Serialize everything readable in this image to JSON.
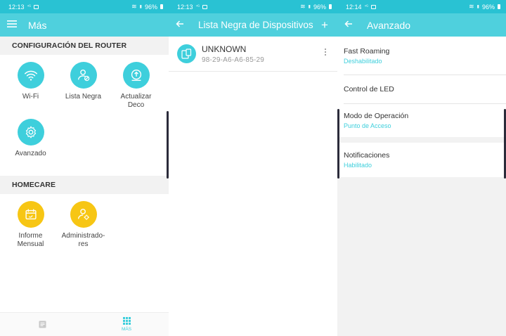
{
  "panels": [
    {
      "status": {
        "time": "12:13",
        "battery": "96%"
      },
      "appbar": {
        "title": "Más"
      },
      "sections": [
        {
          "title": "CONFIGURACIÓN DEL ROUTER",
          "items": [
            {
              "label": "Wi-Fi",
              "icon": "wifi-icon"
            },
            {
              "label": "Lista Negra",
              "icon": "user-block-icon"
            },
            {
              "label": "Actualizar Deco",
              "icon": "firmware-update-icon"
            },
            {
              "label": "Avanzado",
              "icon": "gear-icon"
            }
          ]
        },
        {
          "title": "HOMECARE",
          "items": [
            {
              "label": "Informe Mensual",
              "icon": "calendar-report-icon"
            },
            {
              "label": "Administrado-res",
              "icon": "user-admin-icon"
            }
          ]
        }
      ],
      "bottom_nav": {
        "second_label": "MÁS"
      }
    },
    {
      "status": {
        "time": "12:13",
        "battery": "96%"
      },
      "appbar": {
        "title": "Lista Negra de Dispositivos"
      },
      "device": {
        "name": "UNKNOWN",
        "mac": "98-29-A6-A6-85-29"
      }
    },
    {
      "status": {
        "time": "12:14",
        "battery": "96%"
      },
      "appbar": {
        "title": "Avanzado"
      },
      "settings": [
        {
          "title": "Fast Roaming",
          "subtitle": "Deshabilitado"
        },
        {
          "title": "Control de LED",
          "subtitle": ""
        },
        {
          "title": "Modo de Operación",
          "subtitle": "Punto de Acceso"
        },
        {
          "title": "Notificaciones",
          "subtitle": "Habilitado"
        }
      ]
    }
  ],
  "colors": {
    "status": "#29c2d3",
    "appbar": "#4fd0dd",
    "accent": "#3ecfdc",
    "homecare": "#f7c614"
  }
}
